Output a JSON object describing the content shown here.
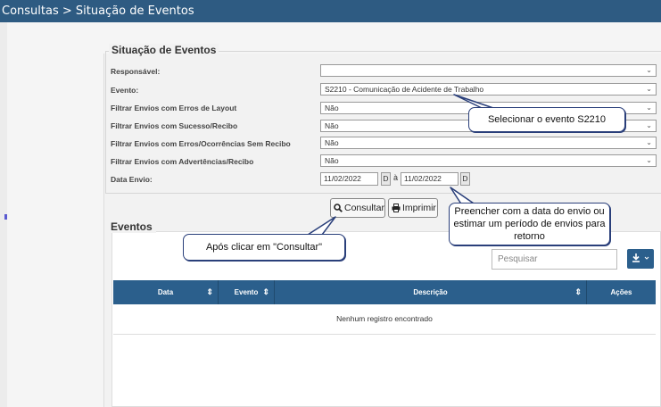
{
  "header": {
    "breadcrumb": "Consultas > Situação de Eventos"
  },
  "filters": {
    "legend": "Situação de Eventos",
    "responsavel": {
      "label": "Responsável:",
      "value": ""
    },
    "evento": {
      "label": "Evento:",
      "value": "S2210 - Comunicação de Acidente de Trabalho"
    },
    "erros_layout": {
      "label": "Filtrar Envios com Erros de Layout",
      "value": "Não"
    },
    "sucesso_recibo": {
      "label": "Filtrar Envios com Sucesso/Recibo",
      "value": "Não"
    },
    "erros_ocorrencias": {
      "label": "Filtrar Envios com Erros/Ocorrências Sem Recibo",
      "value": "Não"
    },
    "advertencias": {
      "label": "Filtrar Envios com Advertências/Recibo",
      "value": "Não"
    },
    "data_envio": {
      "label": "Data Envio:",
      "start": "11/02/2022",
      "end": "11/02/2022",
      "separator": "à",
      "picker_label": "D"
    },
    "caret": "⌄"
  },
  "actions": {
    "consultar": "Consultar",
    "imprimir": "Imprimir"
  },
  "eventos": {
    "title": "Eventos",
    "search_placeholder": "Pesquisar",
    "columns": [
      "Data",
      "Evento",
      "Descrição",
      "Ações"
    ],
    "empty_message": "Nenhum registro encontrado"
  },
  "callouts": {
    "select_event": "Selecionar o evento S2210",
    "date_hint": "Preencher com a data do envio ou estimar um período de envios para retorno",
    "after_click": "Após clicar em \"Consultar\""
  },
  "colors": {
    "header": "#2e5b82",
    "table_header": "#2b5f8c",
    "callout_border": "#2a3f7a"
  },
  "icons": [
    "search-icon",
    "printer-icon",
    "download-icon",
    "sort-icon",
    "chevron-down-icon"
  ]
}
